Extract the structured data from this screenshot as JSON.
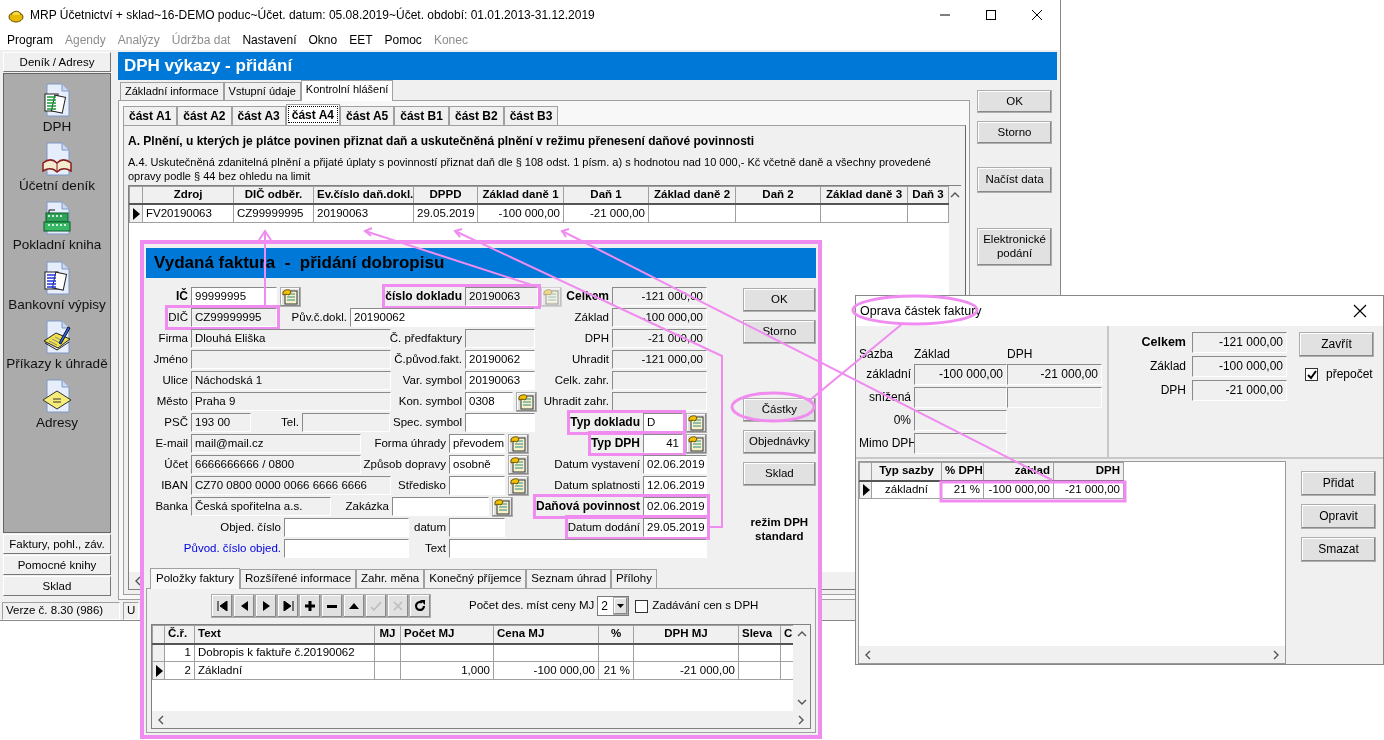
{
  "window": {
    "title": "MRP Účetnictví + sklad~16-DEMO poduc~Účet. datum: 05.08.2019~Účet. období: 01.01.2013-31.12.2019"
  },
  "menu": [
    {
      "label": "Program",
      "disabled": false
    },
    {
      "label": "Agendy",
      "disabled": true
    },
    {
      "label": "Analýzy",
      "disabled": true
    },
    {
      "label": "Údržba dat",
      "disabled": true
    },
    {
      "label": "Nastavení",
      "disabled": false
    },
    {
      "label": "Okno",
      "disabled": false
    },
    {
      "label": "EET",
      "disabled": false
    },
    {
      "label": "Pomoc",
      "disabled": false
    },
    {
      "label": "Konec",
      "disabled": true
    }
  ],
  "sidebar": {
    "header": "Deník / Adresy",
    "items": [
      {
        "label": "DPH",
        "kind": "vat"
      },
      {
        "label": "Účetní deník",
        "kind": "journal"
      },
      {
        "label": "Pokladní kniha",
        "kind": "cash"
      },
      {
        "label": "Bankovní výpisy",
        "kind": "bank"
      },
      {
        "label": "Příkazy k úhradě",
        "kind": "payment"
      },
      {
        "label": "Adresy",
        "kind": "address"
      }
    ],
    "sections": [
      "Faktury, pohl., záv.",
      "Pomocné knihy",
      "Sklad"
    ]
  },
  "main": {
    "title": "DPH výkazy - přidání",
    "tabs": [
      {
        "label": "Základní informace",
        "selected": false
      },
      {
        "label": "Vstupní údaje",
        "selected": false
      },
      {
        "label": "Kontrolní hlášení",
        "selected": true
      }
    ],
    "part_tabs": [
      {
        "label": "část A1",
        "selected": false
      },
      {
        "label": "část A2",
        "selected": false
      },
      {
        "label": "část A3",
        "selected": false
      },
      {
        "label": "část A4",
        "selected": true
      },
      {
        "label": "část A5",
        "selected": false
      },
      {
        "label": "část B1",
        "selected": false
      },
      {
        "label": "část B2",
        "selected": false
      },
      {
        "label": "část B3",
        "selected": false
      }
    ],
    "heading": "A. Plnění, u kterých je plátce povinen přiznat daň a uskutečněná plnění v režimu přenesení daňové povinnosti",
    "description": "A.4. Uskutečněná zdanitelná plnění a přijaté úplaty s povinností přiznat daň dle § 108 odst. 1 písm. a) s hodnotou nad 10 000,- Kč včetně daně a všechny provedené opravy podle § 44 bez ohledu na limit",
    "table": {
      "columns": [
        "Zdroj",
        "DIČ odběr.",
        "Ev.číslo daň.dokl.",
        "DPPD",
        "Základ daně 1",
        "Daň 1",
        "Základ daně 2",
        "Daň 2",
        "Základ daně 3",
        "Daň 3"
      ],
      "rows": [
        {
          "selected": true,
          "cells": [
            "FV20190063",
            "CZ99999995",
            "20190063",
            "29.05.2019",
            "-100 000,00",
            "-21 000,00"
          ]
        }
      ]
    },
    "buttons": [
      "OK",
      "Storno",
      "Načíst data",
      "Elektronické podání"
    ]
  },
  "status_bar": [
    "Verze č. 8.30 (986)",
    "U"
  ],
  "invoice": {
    "title": "Vydaná faktura  -  přidání dobropisu",
    "form_rows": [
      [
        {
          "label": "IČ",
          "value": "99999995",
          "editable": true,
          "bold": true,
          "highlighted": false,
          "lookup": {
            "disabled": false
          }
        },
        {
          "label": "číslo dokladu",
          "value": "20190063",
          "editable": false,
          "bold": true,
          "highlighted": true,
          "lookup": {
            "disabled": true
          }
        },
        {
          "label": "Celkem",
          "value": "-121 000,00",
          "editable": false,
          "bold": true,
          "highlighted": false
        }
      ],
      [
        {
          "label": "DIČ",
          "value": "CZ99999995",
          "editable": false,
          "bold": false,
          "highlighted": true
        },
        {
          "label": "Pův.č.dokl.",
          "value": "20190062",
          "editable": true,
          "bold": false,
          "highlighted": false
        },
        {
          "label": "Základ",
          "value": "-100 000,00",
          "editable": false,
          "bold": false,
          "highlighted": false
        }
      ],
      [
        {
          "label": "Firma",
          "value": "Dlouhá Eliška",
          "editable": false,
          "bold": false,
          "highlighted": false
        },
        {
          "label": "Č. předfaktury",
          "editable": false,
          "bold": false,
          "highlighted": false
        },
        {
          "label": "DPH",
          "value": "-21 000,00",
          "editable": false,
          "bold": false,
          "highlighted": false
        }
      ],
      [
        {
          "label": "Jméno",
          "editable": false,
          "bold": false,
          "highlighted": false
        },
        {
          "label": "Č.původ.fakt.",
          "value": "20190062",
          "editable": true,
          "bold": false,
          "highlighted": false
        },
        {
          "label": "Uhradit",
          "value": "-121 000,00",
          "editable": false,
          "bold": false,
          "highlighted": false
        }
      ],
      [
        {
          "label": "Ulice",
          "value": "Náchodská 1",
          "editable": false,
          "bold": false,
          "highlighted": false
        },
        {
          "label": "Var. symbol",
          "value": "20190063",
          "editable": true,
          "bold": false,
          "highlighted": false
        },
        {
          "label": "Celk. zahr.",
          "editable": false,
          "bold": false,
          "highlighted": false
        }
      ],
      [
        {
          "label": "Město",
          "value": "Praha 9",
          "editable": false,
          "bold": false,
          "highlighted": false
        },
        {
          "label": "Kon. symbol",
          "value": "0308",
          "editable": true,
          "bold": false,
          "highlighted": false,
          "lookup": {
            "disabled": false
          }
        },
        {
          "label": "Uhradit zahr.",
          "editable": false,
          "bold": false,
          "highlighted": false
        }
      ],
      [
        {
          "label": "PSČ",
          "value": "193 00",
          "editable": false,
          "bold": false,
          "highlighted": false
        },
        {
          "label": "Tel.",
          "editable": false,
          "bold": false,
          "highlighted": false
        },
        {
          "label": "Spec. symbol",
          "editable": true,
          "bold": false,
          "highlighted": false
        },
        {
          "label": "Typ dokladu",
          "value": "D",
          "editable": true,
          "bold": true,
          "highlighted": true,
          "lookup": {
            "disabled": false
          }
        }
      ],
      [
        {
          "label": "E-mail",
          "value": "mail@mail.cz",
          "editable": false,
          "bold": false,
          "highlighted": false
        },
        {
          "label": "Forma úhrady",
          "value": "převodem",
          "editable": true,
          "bold": false,
          "highlighted": false,
          "lookup": {
            "disabled": false
          }
        },
        {
          "label": "Typ DPH",
          "value": "41",
          "editable": true,
          "bold": true,
          "highlighted": true,
          "lookup": {
            "disabled": false
          }
        }
      ],
      [
        {
          "label": "Účet",
          "value": "6666666666 / 0800",
          "editable": false,
          "bold": false,
          "highlighted": false
        },
        {
          "label": "Způsob dopravy",
          "value": "osobně",
          "editable": true,
          "bold": false,
          "highlighted": false,
          "lookup": {
            "disabled": false
          }
        },
        {
          "label": "Datum vystavení",
          "value": "02.06.2019",
          "editable": true,
          "bold": false,
          "highlighted": false
        }
      ],
      [
        {
          "label": "IBAN",
          "value": "CZ70 0800 0000 0066 6666 6666",
          "editable": false,
          "bold": false,
          "highlighted": false
        },
        {
          "label": "Středisko",
          "editable": true,
          "bold": false,
          "highlighted": false,
          "lookup": {
            "disabled": false
          }
        },
        {
          "label": "Datum splatnosti",
          "value": "12.06.2019",
          "editable": true,
          "bold": false,
          "highlighted": false
        }
      ],
      [
        {
          "label": "Banka",
          "value": "Česká spořitelna a.s.",
          "editable": false,
          "bold": false,
          "highlighted": false
        },
        {
          "label": "Zakázka",
          "editable": true,
          "bold": false,
          "highlighted": false,
          "lookup": {
            "disabled": false
          }
        },
        {
          "label": "Daňová povinnost",
          "value": "02.06.2019",
          "editable": true,
          "bold": true,
          "highlighted": true
        }
      ],
      [
        {
          "label": "Objed. číslo",
          "editable": true,
          "bold": false,
          "highlighted": false
        },
        {
          "label": "datum",
          "editable": true,
          "bold": false,
          "highlighted": false
        },
        {
          "label": "Datum dodání",
          "value": "29.05.2019",
          "editable": true,
          "bold": false,
          "highlighted": true
        }
      ],
      [
        {
          "label": "Původ. číslo objed.",
          "editable": true,
          "bold": false,
          "highlighted": false,
          "link": true
        },
        {
          "label": "Text",
          "editable": true,
          "bold": false,
          "highlighted": false
        }
      ]
    ],
    "buttons": [
      "OK",
      "Storno",
      "Částky",
      "Objednávky",
      "Sklad"
    ],
    "mode": "režim DPH standard",
    "tabs": [
      {
        "label": "Položky faktury",
        "selected": true
      },
      {
        "label": "Rozšířené informace",
        "selected": false
      },
      {
        "label": "Zahr. měna",
        "selected": false
      },
      {
        "label": "Konečný příjemce",
        "selected": false
      },
      {
        "label": "Seznam úhrad",
        "selected": false
      },
      {
        "label": "Přílohy",
        "selected": false
      }
    ],
    "nav_buttons": [
      {
        "kind": "first",
        "disabled": false
      },
      {
        "kind": "previous",
        "disabled": false
      },
      {
        "kind": "next",
        "disabled": false
      },
      {
        "kind": "last",
        "disabled": false
      },
      {
        "kind": "add",
        "disabled": false
      },
      {
        "kind": "remove",
        "disabled": false
      },
      {
        "kind": "up",
        "disabled": false
      },
      {
        "kind": "confirm",
        "disabled": true
      },
      {
        "kind": "cancel",
        "disabled": true
      },
      {
        "kind": "refresh",
        "disabled": false
      }
    ],
    "decimals_label": "Počet des. míst ceny MJ",
    "decimals": "2",
    "vat_prices": {
      "label": "Zadávání cen s DPH",
      "checked": false
    },
    "table": {
      "columns": [
        "Č.ř.",
        "Text",
        "MJ",
        "Počet MJ",
        "Cena MJ",
        "%",
        "DPH MJ",
        "Sleva",
        "C"
      ],
      "rows": [
        {
          "selected": false,
          "cells": [
            "1",
            "Dobropis k faktuře č.20190062"
          ]
        },
        {
          "selected": true,
          "cells": [
            "2",
            "Základní",
            null,
            "1,000",
            "-100 000,00",
            "21 %",
            "-21 000,00"
          ]
        }
      ]
    }
  },
  "correction": {
    "title": "Oprava částek faktury",
    "rate_headers": [
      "Sazba",
      "Základ",
      "DPH"
    ],
    "rates": [
      {
        "label": "základní",
        "kind": "pair",
        "values": [
          "-100 000,00",
          "-21 000,00"
        ]
      },
      {
        "label": "snížená",
        "kind": "pair"
      },
      {
        "label": "0%",
        "kind": "single"
      },
      {
        "label": "Mimo DPH",
        "kind": "single"
      }
    ],
    "totals": [
      {
        "label": "Celkem",
        "value": "-121 000,00",
        "bold": true
      },
      {
        "label": "Základ",
        "value": "-100 000,00",
        "bold": false
      },
      {
        "label": "DPH",
        "value": "-21 000,00",
        "bold": false
      }
    ],
    "close_button": "Zavřít",
    "recalc": {
      "label": "přepočet",
      "checked": true
    },
    "table": {
      "columns": [
        "Typ sazby",
        "% DPH",
        "základ",
        "DPH"
      ],
      "rows": [
        {
          "selected": true,
          "cells": [
            "základní",
            "21 %",
            "-100 000,00",
            "-21 000,00"
          ]
        }
      ]
    },
    "buttons": [
      "Přidat",
      "Opravit",
      "Smazat"
    ]
  }
}
